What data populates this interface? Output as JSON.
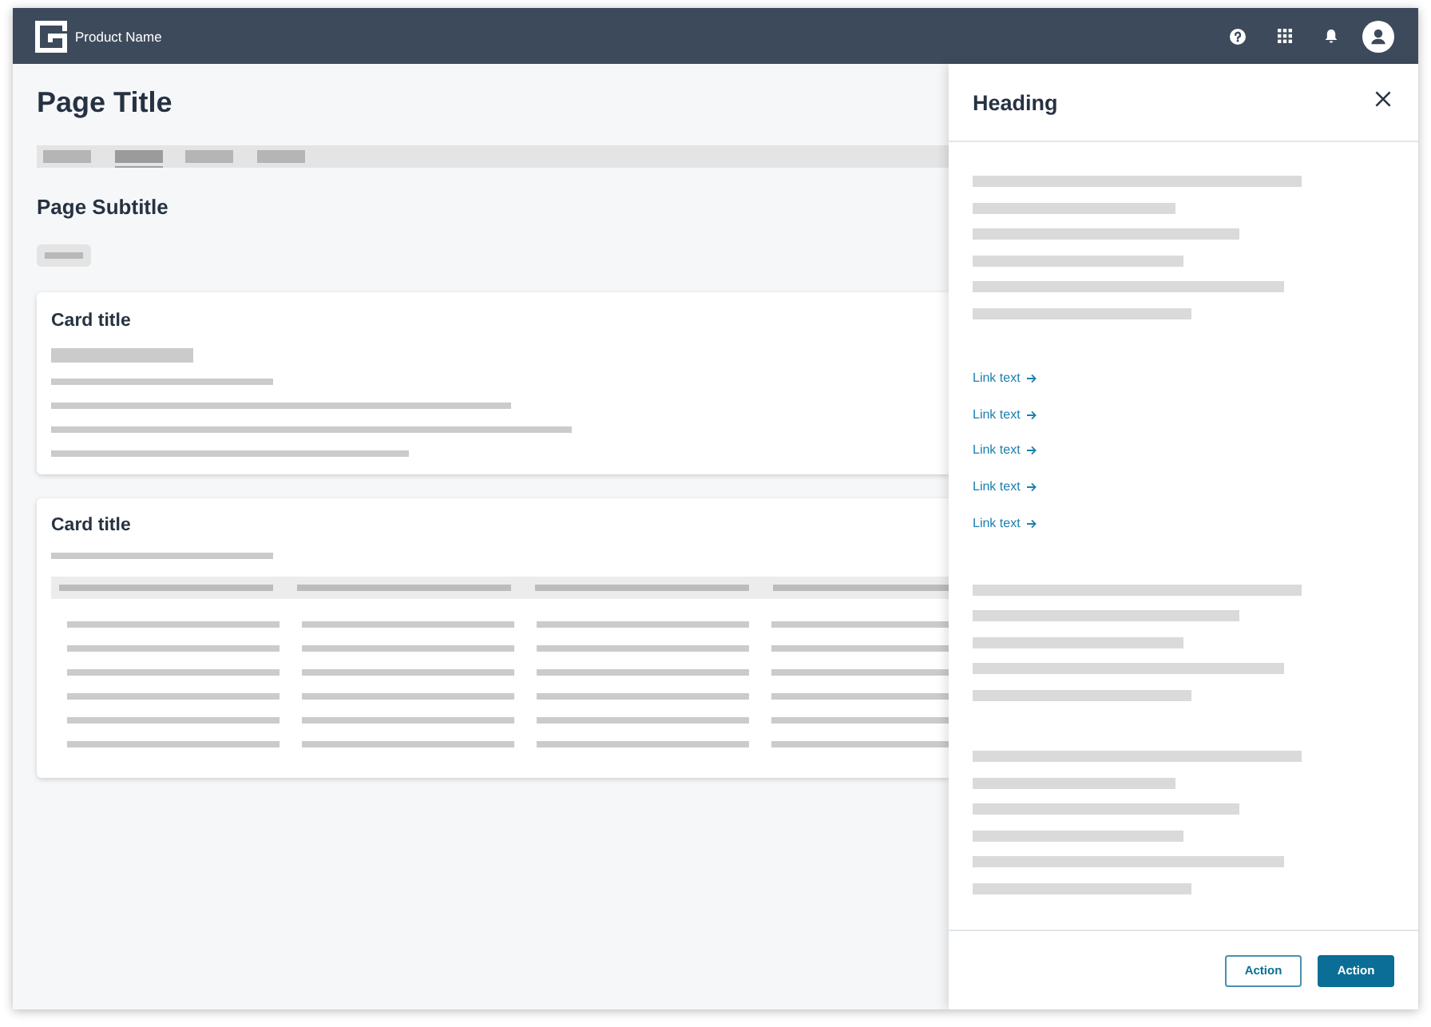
{
  "top_bar": {
    "product_name": "Product Name"
  },
  "page": {
    "title": "Page Title",
    "tabs": [
      {
        "selected": false
      },
      {
        "selected": true
      },
      {
        "selected": false
      },
      {
        "selected": false
      }
    ],
    "subtitle": "Page Subtitle"
  },
  "cards": [
    {
      "title": "Card title",
      "kind": "text"
    },
    {
      "title": "Card title",
      "kind": "table"
    }
  ],
  "side_panel": {
    "heading": "Heading",
    "links": [
      {
        "label": "Link text"
      },
      {
        "label": "Link text"
      },
      {
        "label": "Link text"
      },
      {
        "label": "Link text"
      },
      {
        "label": "Link text"
      }
    ],
    "actions": [
      {
        "label": "Action",
        "kind": "secondary"
      },
      {
        "label": "Action",
        "kind": "primary"
      }
    ]
  }
}
